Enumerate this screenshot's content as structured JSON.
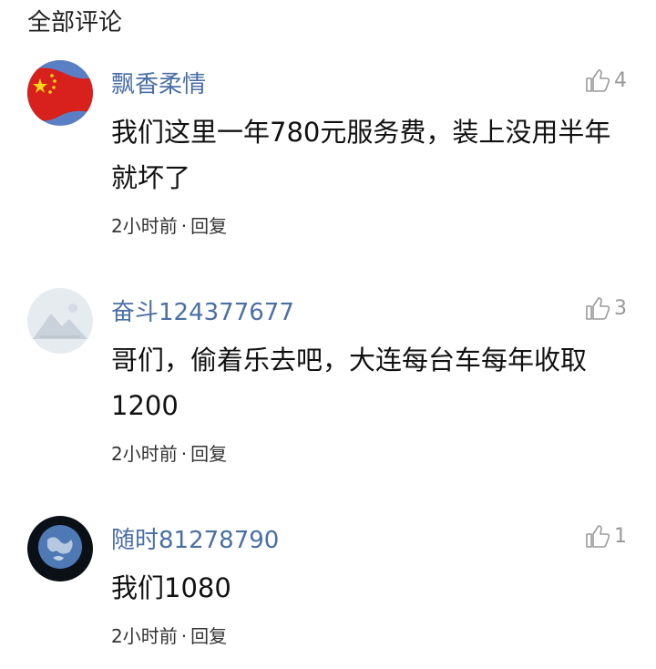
{
  "section": {
    "title": "全部评论"
  },
  "comments": [
    {
      "username": "飘香柔情",
      "likes": "4",
      "text": "我们这里一年780元服务费，装上没用半年就坏了",
      "time": "2小时前",
      "separator": "·",
      "reply": "回复",
      "avatar_icon": "china-flag-avatar"
    },
    {
      "username": "奋斗124377677",
      "likes": "3",
      "text": "哥们，偷着乐去吧，大连每台车每年收取1200",
      "time": "2小时前",
      "separator": "·",
      "reply": "回复",
      "avatar_icon": "default-landscape-avatar"
    },
    {
      "username": "随时81278790",
      "likes": "1",
      "text": "我们1080",
      "time": "2小时前",
      "separator": "·",
      "reply": "回复",
      "avatar_icon": "earth-avatar"
    }
  ],
  "colors": {
    "username": "#4a6fa5",
    "meta": "#333333",
    "like": "#999999"
  }
}
